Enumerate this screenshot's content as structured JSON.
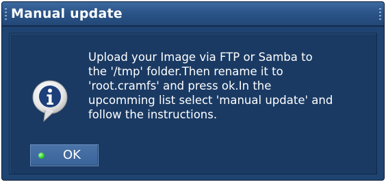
{
  "dialog": {
    "title": "Manual update",
    "message": "Upload your Image via FTP or Samba to\nthe '/tmp' folder.Then rename it to\n'root.cramfs' and press ok.In the\nupcomming list select 'manual update' and\nfollow the instructions.",
    "icon": "info-icon",
    "ok_button": {
      "label": "OK",
      "indicator": "green-led-icon",
      "indicator_color": "#23d21c"
    }
  },
  "colors": {
    "dialog_background": "#1f4471",
    "titlebar": "#2a5387",
    "text": "#ffffff"
  }
}
